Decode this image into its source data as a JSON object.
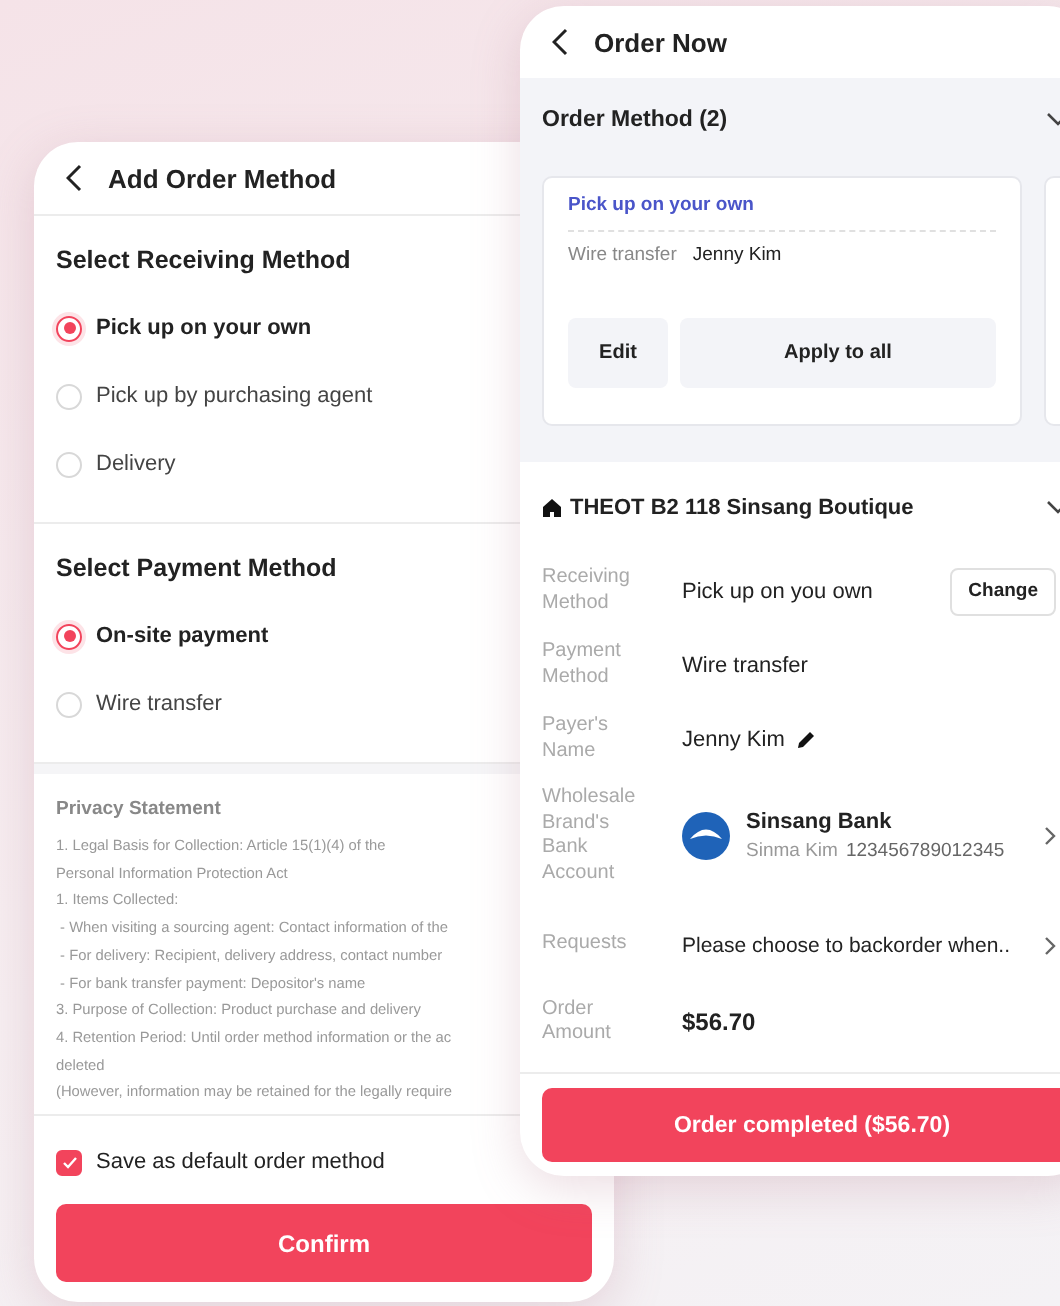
{
  "add_order_method": {
    "title": "Add Order Method",
    "sections": [
      {
        "heading": "Select Receiving Method",
        "options": [
          {
            "label": "Pick up on your own",
            "selected": true
          },
          {
            "label": "Pick up by purchasing agent",
            "selected": false
          },
          {
            "label": "Delivery",
            "selected": false
          }
        ]
      },
      {
        "heading": "Select Payment Method",
        "options": [
          {
            "label": "On-site payment",
            "selected": true
          },
          {
            "label": "Wire transfer",
            "selected": false
          }
        ]
      }
    ],
    "privacy": {
      "heading": "Privacy Statement",
      "lines": [
        "1. Legal Basis for Collection: Article 15(1)(4) of the",
        "Personal Information Protection Act",
        "1. Items Collected:",
        " - When visiting a sourcing agent: Contact information of the",
        " - For delivery: Recipient, delivery address, contact number",
        " - For bank transfer payment: Depositor's name",
        "3. Purpose of Collection: Product purchase and delivery",
        "4. Retention Period: Until order method information or the ac",
        "deleted",
        "(However, information may be retained for the legally require"
      ]
    },
    "save_default": {
      "label": "Save as default order method",
      "checked": true
    },
    "confirm_button": "Confirm"
  },
  "order_now": {
    "title": "Order Now",
    "order_method": {
      "heading": "Order Method (2)",
      "cards": [
        {
          "receiving": "Pick up on your own",
          "payment": "Wire transfer",
          "payer": "Jenny Kim",
          "buttons": [
            "Edit",
            "Apply to all"
          ]
        }
      ]
    },
    "store": {
      "name": "THEOT B2 118 Sinsang Boutique",
      "fields": [
        {
          "kind": "action",
          "label": "Receiving Method",
          "value": "Pick up on you own",
          "action": "Change"
        },
        {
          "kind": "text",
          "label": "Payment Method",
          "value": "Wire transfer"
        },
        {
          "kind": "editable",
          "label": "Payer's Name",
          "value": "Jenny Kim"
        },
        {
          "kind": "bank",
          "label": "Wholesale Brand's Bank Account",
          "bank": "Sinsang Bank",
          "holder": "Sinma Kim",
          "account_number": "123456789012345"
        },
        {
          "kind": "link",
          "label": "Requests",
          "value": "Please choose to backorder when.."
        },
        {
          "kind": "amount",
          "label": "Order Amount",
          "value": "$56.70"
        }
      ]
    },
    "order_button": "Order completed ($56.70)"
  }
}
